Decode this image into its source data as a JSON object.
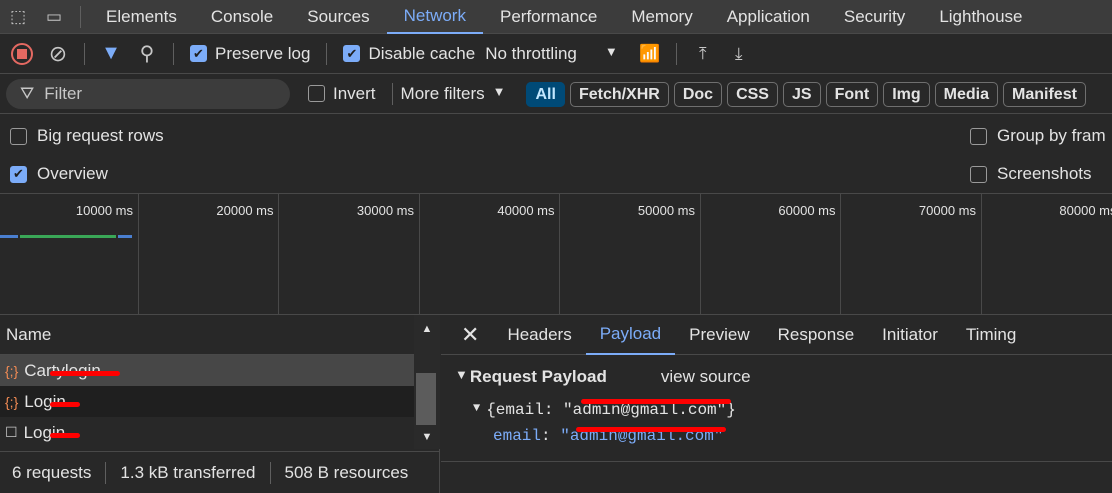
{
  "tabs": [
    "Elements",
    "Console",
    "Sources",
    "Network",
    "Performance",
    "Memory",
    "Application",
    "Security",
    "Lighthouse"
  ],
  "active_tab": "Network",
  "toolbar": {
    "preserve_log": "Preserve log",
    "disable_cache": "Disable cache",
    "throttling": "No throttling"
  },
  "filterbar": {
    "filter_placeholder": "Filter",
    "invert": "Invert",
    "more_filters": "More filters",
    "types": [
      "All",
      "Fetch/XHR",
      "Doc",
      "CSS",
      "JS",
      "Font",
      "Img",
      "Media",
      "Manifest"
    ]
  },
  "options": {
    "big_rows": "Big request rows",
    "overview": "Overview",
    "group_by_frame": "Group by fram",
    "screenshots": "Screenshots"
  },
  "timeline": {
    "ticks": [
      "10000 ms",
      "20000 ms",
      "30000 ms",
      "40000 ms",
      "50000 ms",
      "60000 ms",
      "70000 ms",
      "80000 ms"
    ]
  },
  "requests": {
    "header": "Name",
    "items": [
      {
        "name": "Cartylogin",
        "type": "xhr"
      },
      {
        "name": "Login",
        "type": "xhr"
      },
      {
        "name": "Login",
        "type": "doc"
      }
    ]
  },
  "status": {
    "requests": "6 requests",
    "transferred": "1.3 kB transferred",
    "resources": "508 B resources"
  },
  "details": {
    "tabs": [
      "Headers",
      "Payload",
      "Preview",
      "Response",
      "Initiator",
      "Timing"
    ],
    "active": "Payload",
    "section": "Request Payload",
    "view_source": "view source",
    "summary": "{email: \"admin@gmail.com\"}",
    "key": "email",
    "value": "\"admin@gmail.com\""
  }
}
